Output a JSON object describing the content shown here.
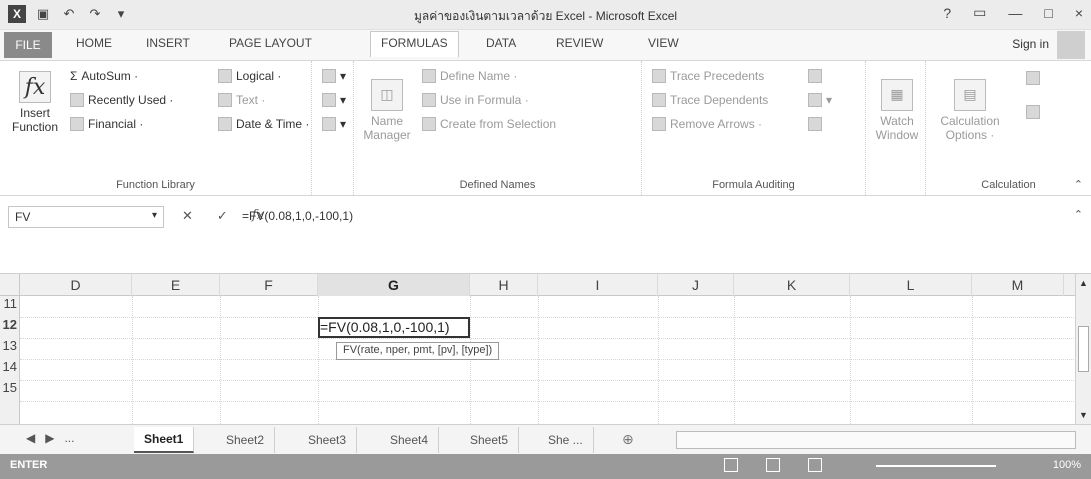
{
  "window": {
    "title": "มูลค่าของเงินตามเวลาด้วย Excel - Microsoft Excel",
    "help": "?",
    "minimize": "—",
    "restore": "□",
    "close": "×"
  },
  "tabs": {
    "file": "FILE",
    "items": [
      "HOME",
      "INSERT",
      "PAGE LAYOUT",
      "FORMULAS",
      "DATA",
      "REVIEW",
      "VIEW"
    ],
    "active": "FORMULAS",
    "signin": "Sign in"
  },
  "ribbon": {
    "function_library": {
      "label": "Function Library",
      "insert_function": "Insert Function",
      "autosum": "AutoSum ·",
      "recently_used": "Recently Used ·",
      "financial": "Financial ·",
      "logical": "Logical ·",
      "text": "Text ·",
      "date_time": "Date & Time ·"
    },
    "defined_names": {
      "label": "Defined Names",
      "name_manager": "Name Manager",
      "define_name": "Define Name ·",
      "use_in_formula": "Use in Formula ·",
      "create_from_selection": "Create from Selection"
    },
    "formula_auditing": {
      "label": "Formula Auditing",
      "trace_precedents": "Trace Precedents",
      "trace_dependents": "Trace Dependents",
      "remove_arrows": "Remove Arrows ·",
      "watch_window": "Watch Window"
    },
    "calculation": {
      "label": "Calculation",
      "calculation_options": "Calculation Options ·"
    }
  },
  "formula_bar": {
    "name_box": "FV",
    "cancel": "✕",
    "enter": "✓",
    "fx": "fx",
    "formula": "=FV(0.08,1,0,-100,1)"
  },
  "sheet": {
    "columns": [
      "D",
      "E",
      "F",
      "G",
      "H",
      "I",
      "J",
      "K",
      "L",
      "M"
    ],
    "selected_column": "G",
    "rows": [
      "11",
      "12",
      "13",
      "14",
      "15"
    ],
    "active_cell_text": "=FV(0.08,1,0,-100,1)",
    "tooltip": "FV(rate, nper, pmt, [pv], [type])"
  },
  "sheet_tabs": {
    "ellipsis": "...",
    "items": [
      "Sheet1",
      "Sheet2",
      "Sheet3",
      "Sheet4",
      "Sheet5",
      "She ..."
    ],
    "active": "Sheet1",
    "add": "⊕"
  },
  "status": {
    "mode": "ENTER",
    "zoom": "100%"
  }
}
